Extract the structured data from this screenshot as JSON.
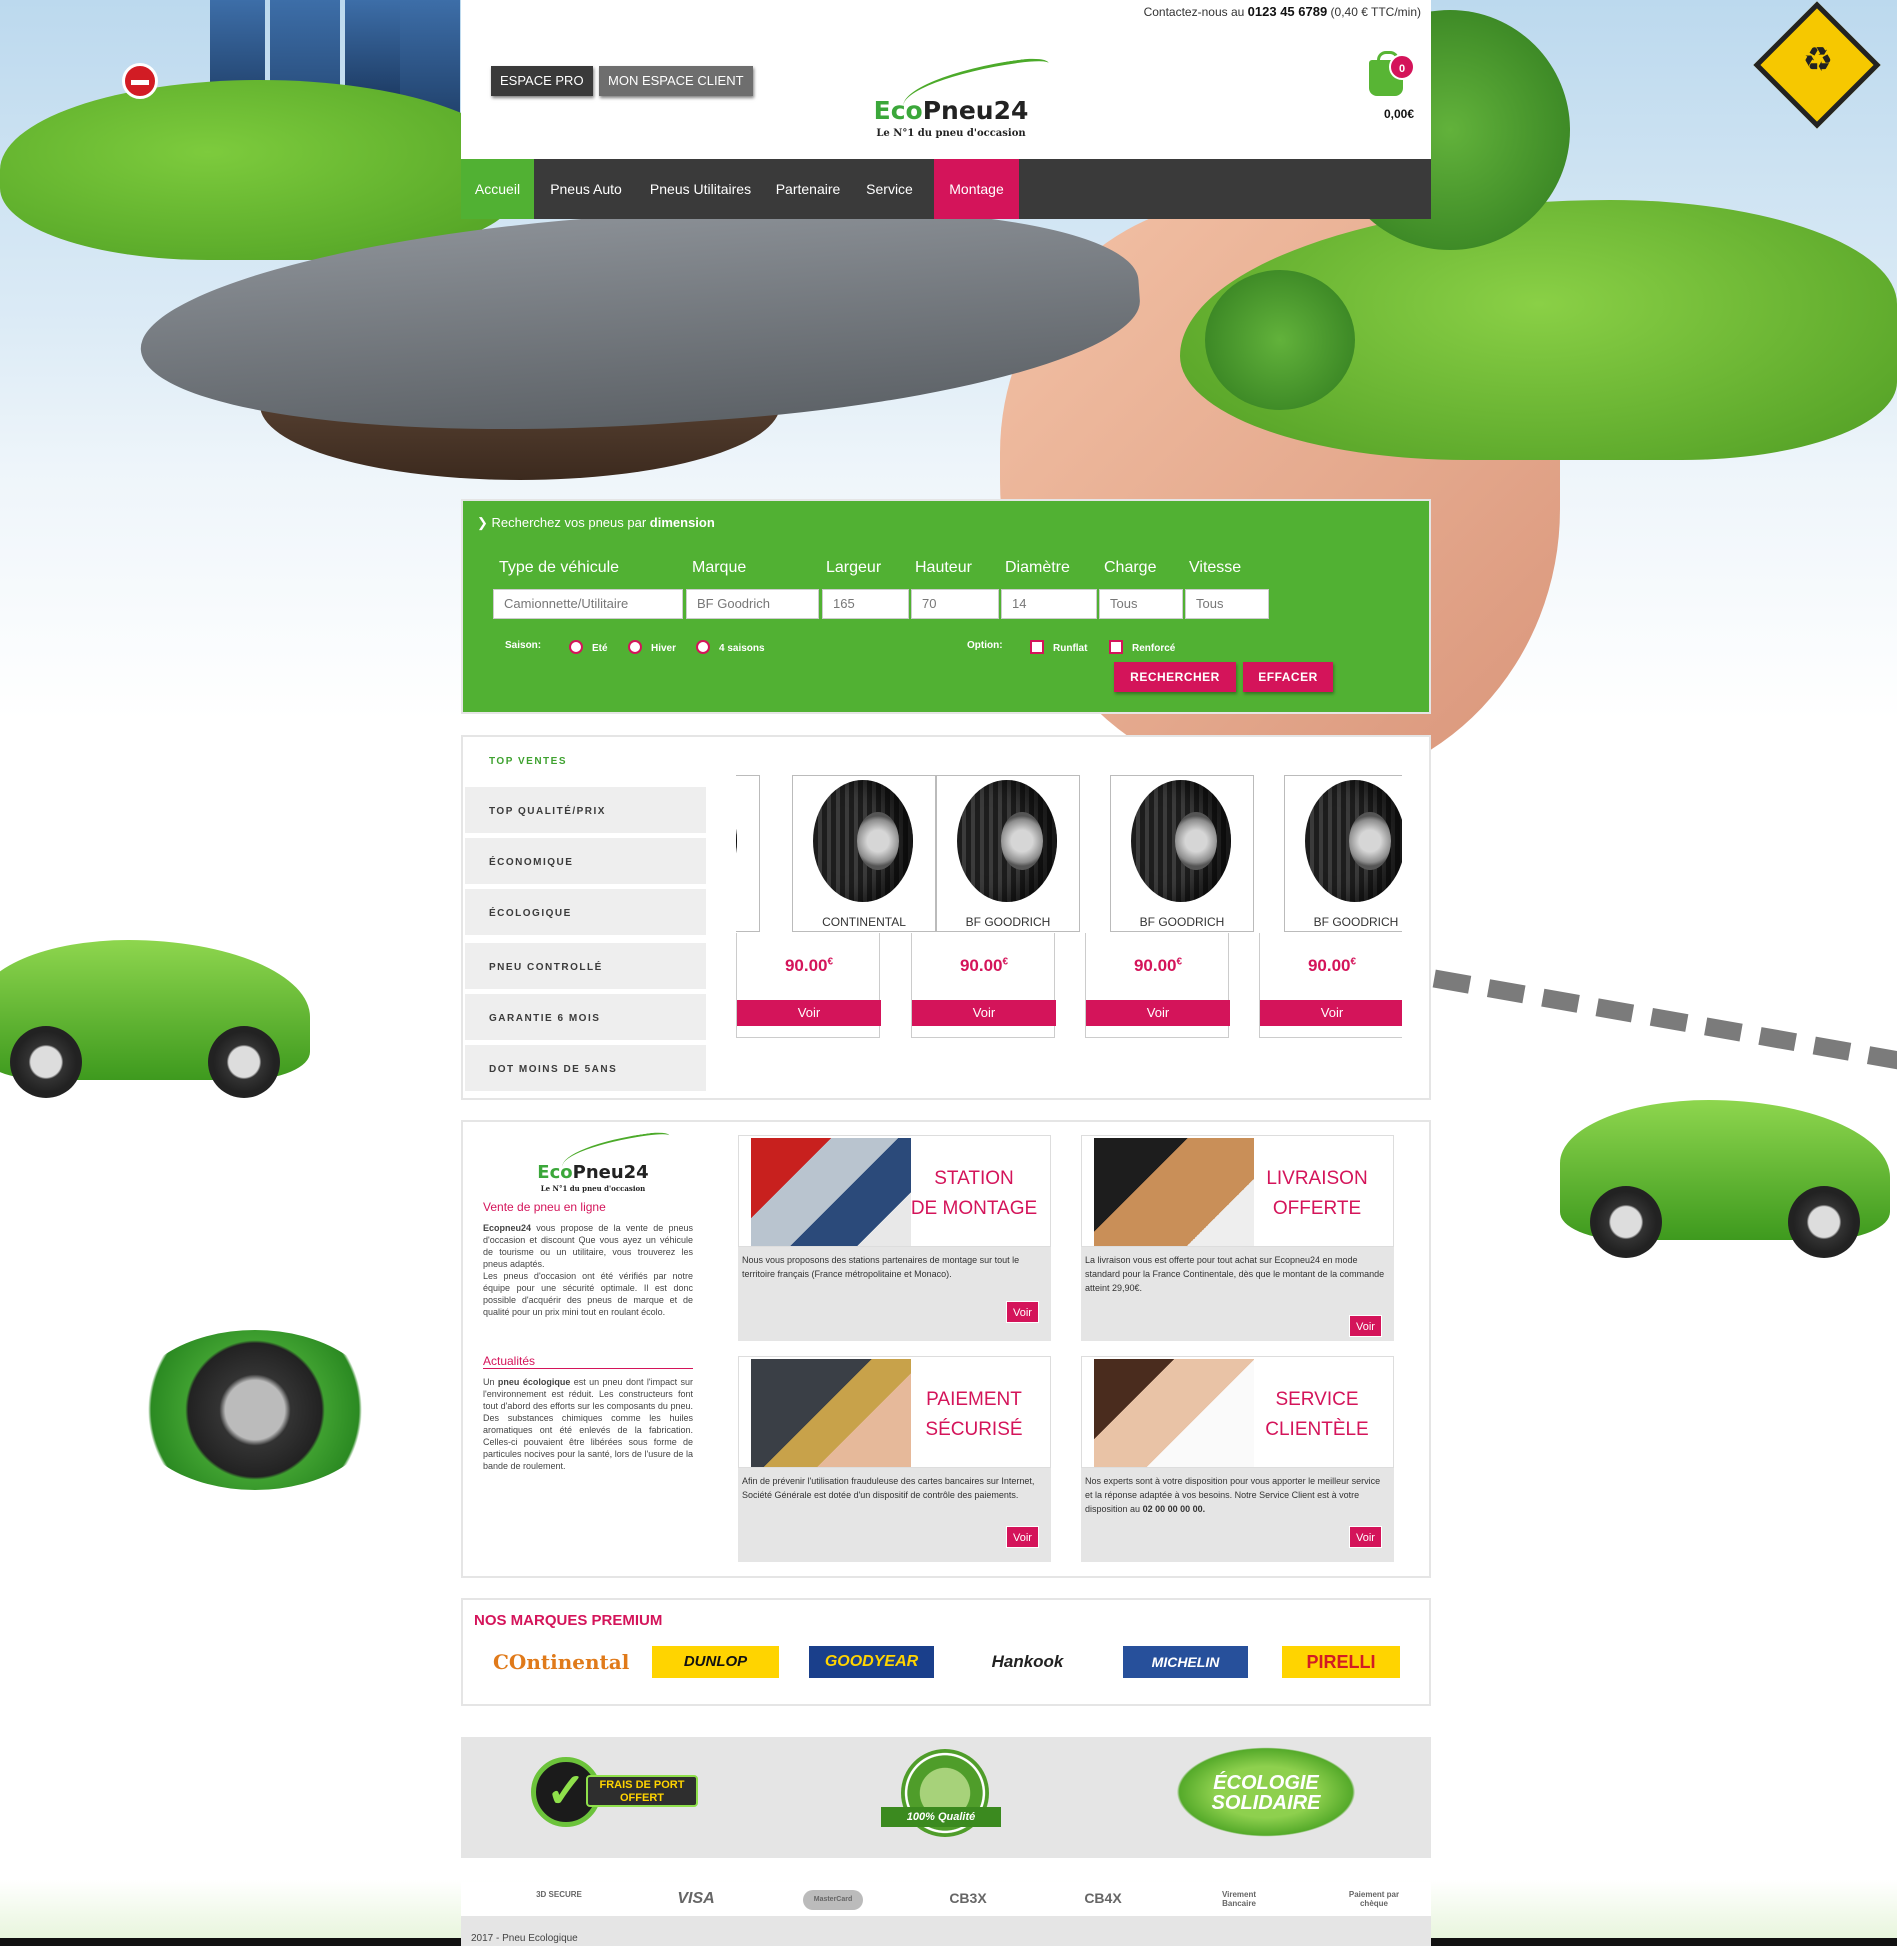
{
  "topbar": {
    "contact_prefix": "Contactez-nous au",
    "phone": "0123 45 6789",
    "rate": "(0,40 € TTC/min)"
  },
  "header": {
    "btn_pro": "ESPACE PRO",
    "btn_client": "MON ESPACE CLIENT",
    "logo_eco": "Eco",
    "logo_rest": "Pneu24",
    "logo_tagline": "Le N°1 du pneu d'occasion",
    "cart_count": "0",
    "cart_total": "0,00€"
  },
  "nav": [
    "Accueil",
    "Pneus Auto",
    "Pneus Utilitaires",
    "Partenaire",
    "Service",
    "Montage"
  ],
  "search": {
    "title_prefix": "Recherchez vos pneus par",
    "title_bold": "dimension",
    "labels": [
      "Type de véhicule",
      "Marque",
      "Largeur",
      "Hauteur",
      "Diamètre",
      "Charge",
      "Vitesse"
    ],
    "values": [
      "Camionnette/Utilitaire",
      "BF Goodrich",
      "165",
      "70",
      "14",
      "Tous",
      "Tous"
    ],
    "season_label": "Saison:",
    "seasons": [
      "Eté",
      "Hiver",
      "4 saisons"
    ],
    "option_label": "Option:",
    "options": [
      "Runflat",
      "Renforcé"
    ],
    "btn_search": "RECHERCHER",
    "btn_clear": "EFFACER"
  },
  "tabs": [
    "TOP VENTES",
    "TOP QUALITÉ/PRIX",
    "ÉCONOMIQUE",
    "ÉCOLOGIQUE",
    "PNEU CONTROLLÉ",
    "GARANTIE 6 MOIS",
    "DOT MOINS DE 5ANS"
  ],
  "products": [
    {
      "brand": "CONTINENTAL",
      "price": "90.00",
      "currency": "€",
      "button": "Voir"
    },
    {
      "brand": "BF GOODRICH",
      "price": "90.00",
      "currency": "€",
      "button": "Voir"
    },
    {
      "brand": "BF GOODRICH",
      "price": "90.00",
      "currency": "€",
      "button": "Voir"
    },
    {
      "brand": "BF GOODRICH",
      "price": "90.00",
      "currency": "€",
      "button": "Voir"
    }
  ],
  "about": {
    "heading": "Vente de pneu en ligne",
    "brand_name": "Ecopneu24",
    "text1": "vous propose de la vente de pneus d'occasion et discount Que vous ayez un véhicule de tourisme ou un utilitaire, vous trouverez les pneus adaptés.",
    "text2": "Les pneus d'occasion ont été vérifiés par notre équipe pour une sécurité optimale. Il est donc possible d'acquérir des pneus de marque et de qualité pour un prix mini tout en roulant écolo.",
    "news_heading": "Actualités",
    "news_prefix": "Un",
    "news_bold": "pneu écologique",
    "news_text": "est un pneu dont l'impact sur l'environnement est réduit. Les constructeurs font tout d'abord des efforts sur les composants du pneu. Des substances chimiques comme les huiles aromatiques ont été enlevés de la fabrication. Celles-ci pouvaient être libérées sous forme de particules nocives pour la santé, lors de l'usure de la bande de roulement."
  },
  "features": [
    {
      "title1": "STATION",
      "title2": "DE MONTAGE",
      "text": "Nous vous proposons des stations partenaires de montage sur tout le territoire français (France métropolitaine et Monaco).",
      "button": "Voir"
    },
    {
      "title1": "LIVRAISON",
      "title2": "OFFERTE",
      "text": "La livraison vous est offerte pour tout achat sur Ecopneu24 en mode standard pour la France Continentale, dès que le montant de la commande atteint 29,90€.",
      "button": "Voir"
    },
    {
      "title1": "PAIEMENT",
      "title2": "SÉCURISÉ",
      "text": "Afin de prévenir l'utilisation frauduleuse des cartes bancaires sur Internet, Société Générale est dotée d'un dispositif de contrôle des paiements.",
      "button": "Voir"
    },
    {
      "title1": "SERVICE",
      "title2": "CLIENTÈLE",
      "text": "Nos experts sont à votre disposition pour vous apporter le meilleur service et la réponse adaptée à vos besoins. Notre Service Client est à votre disposition au",
      "text_bold": "02 00 00 00 00.",
      "button": "Voir"
    }
  ],
  "brands": {
    "title": "NOS MARQUES PREMIUM",
    "items": [
      "Ontinental",
      "DUNLOP",
      "GOODYEAR",
      "Hankook",
      "MICHELIN",
      "PIRELLI"
    ]
  },
  "badges": [
    {
      "line1": "FRAIS DE PORT",
      "line2": "OFFERT"
    },
    {
      "line1": "100% Qualité"
    },
    {
      "line1": "ÉCOLOGIE",
      "line2": "SOLIDAIRE"
    }
  ],
  "payments": [
    "3D SECURE",
    "VISA",
    "MasterCard",
    "CB3X",
    "CB4X",
    "Virement Bancaire",
    "Paiement par chèque"
  ],
  "footer": "2017 - Pneu Ecologique",
  "colors": {
    "green": "#51b133",
    "pink": "#d4145a",
    "dark": "#3a3a3a",
    "light_gray": "#e5e5e5"
  }
}
